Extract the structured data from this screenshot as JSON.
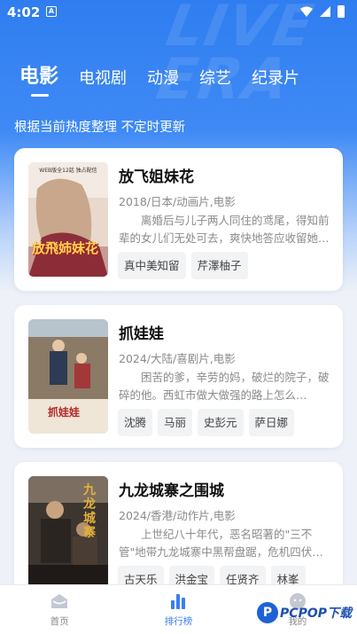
{
  "status": {
    "time": "4:02",
    "app_badge": "A"
  },
  "tabs": [
    {
      "label": "电影",
      "active": true
    },
    {
      "label": "电视剧",
      "active": false
    },
    {
      "label": "动漫",
      "active": false
    },
    {
      "label": "综艺",
      "active": false
    },
    {
      "label": "纪录片",
      "active": false
    }
  ],
  "subtitle": "根据当前热度整理 不定时更新",
  "cards": [
    {
      "title": "放飞姐妹花",
      "meta": "2018/日本/动画片,电影",
      "desc": "离婚后与儿子两人同住的鸢尾，得知前辈的女儿们无处可去，爽快地答应收留她们…",
      "tags": [
        "真中美知留",
        "芹澤柚子"
      ],
      "poster": {
        "main_text": "放飛姉妹花",
        "top_text": "WEB版全12話 独占配信"
      }
    },
    {
      "title": "抓娃娃",
      "meta": "2024/大陆/喜剧片,电影",
      "desc": "困苦的爹，辛劳的妈，破烂的院子，破碎的他。西虹市做大做强的路上怎么…",
      "tags": [
        "沈腾",
        "马丽",
        "史彭元",
        "萨日娜"
      ],
      "poster": {
        "main_text": "抓娃娃"
      }
    },
    {
      "title": "九龙城寨之围城",
      "meta": "2024/香港/动作片,电影",
      "desc": "上世纪八十年代，恶名昭著的\"三不管\"地带九龙城寨中黑帮盘踞，危机四伏…",
      "tags": [
        "古天乐",
        "洪金宝",
        "任贤齐",
        "林峯"
      ],
      "poster": {
        "main_text": "九龙城寨"
      }
    }
  ],
  "bottom_nav": [
    {
      "label": "首页",
      "icon": "home-icon",
      "active": false
    },
    {
      "label": "排行榜",
      "icon": "ranking-icon",
      "active": true
    },
    {
      "label": "我的",
      "icon": "profile-icon",
      "active": false
    }
  ],
  "watermark": {
    "logo_letter": "P",
    "text": "PCPOP下载"
  },
  "colors": {
    "accent": "#3a7ff0",
    "hero_top": "#2f7df0"
  }
}
